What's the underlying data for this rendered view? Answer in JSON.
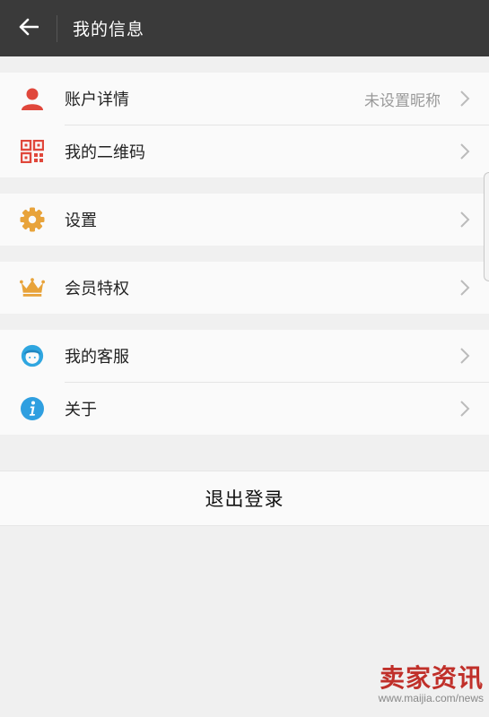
{
  "header": {
    "title": "我的信息",
    "back_icon": "arrow-left-icon"
  },
  "groups": [
    {
      "items": [
        {
          "label": "账户详情",
          "value": "未设置昵称",
          "icon": "user-icon",
          "icon_color": "#e0473b"
        },
        {
          "label": "我的二维码",
          "value": "",
          "icon": "qr-code-icon",
          "icon_color": "#e0473b"
        }
      ]
    },
    {
      "items": [
        {
          "label": "设置",
          "value": "",
          "icon": "gear-icon",
          "icon_color": "#e8a33a"
        }
      ]
    },
    {
      "items": [
        {
          "label": "会员特权",
          "value": "",
          "icon": "crown-icon",
          "icon_color": "#e8a33a"
        }
      ]
    },
    {
      "items": [
        {
          "label": "我的客服",
          "value": "",
          "icon": "customer-service-icon",
          "icon_color": "#2fa6e0"
        },
        {
          "label": "关于",
          "value": "",
          "icon": "info-icon",
          "icon_color": "#2f9fe0"
        }
      ]
    }
  ],
  "logout_label": "退出登录",
  "watermark": {
    "logo_text": "卖家资讯",
    "url": "www.maijia.com/news"
  },
  "colors": {
    "topbar": "#3a3a3a",
    "background": "#f0f0f0",
    "value_text": "#999999"
  }
}
